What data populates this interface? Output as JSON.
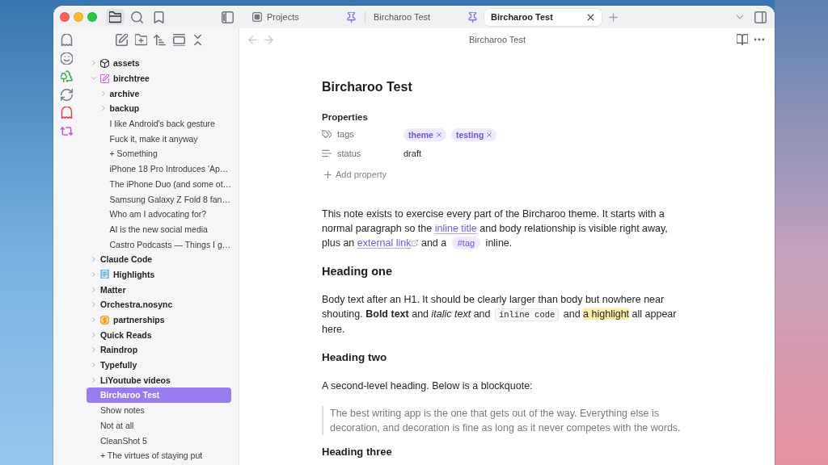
{
  "sidebar_tabs": [
    {
      "selected": true
    },
    {
      "selected": false
    },
    {
      "selected": false
    }
  ],
  "tabs": [
    {
      "kind": "view",
      "label": "Projects",
      "pinned": true,
      "selected": false
    },
    {
      "kind": "note",
      "label": "Bircharoo Test",
      "pinned": true,
      "selected": false
    },
    {
      "kind": "note",
      "label": "Bircharoo Test",
      "pinned": false,
      "selected": true
    }
  ],
  "sidebar": {
    "items": [
      {
        "kind": "folder",
        "label": "assets",
        "expanded": false,
        "selected": false
      },
      {
        "kind": "folder",
        "label": "birchtree",
        "expanded": true,
        "selected": false,
        "children": [
          {
            "kind": "folder",
            "label": "archive",
            "expanded": false,
            "selected": false
          },
          {
            "kind": "folder",
            "label": "backup",
            "expanded": false,
            "selected": false
          },
          {
            "kind": "file",
            "label": "I like Android's back gesture",
            "selected": false
          },
          {
            "kind": "file",
            "label": "Fuck it, make it anyway",
            "selected": false
          },
          {
            "kind": "file",
            "label": "+ Something",
            "selected": false
          },
          {
            "kind": "file",
            "label": "iPhone 18 Pro Introduces 'Ap…",
            "selected": false
          },
          {
            "kind": "file",
            "label": "The iPhone Duo (and some ot…",
            "selected": false
          },
          {
            "kind": "file",
            "label": "Samsung Galaxy Z Fold 8 fan…",
            "selected": false
          },
          {
            "kind": "file",
            "label": "Who am I advocating for?",
            "selected": false
          },
          {
            "kind": "file",
            "label": "AI is the new social media",
            "selected": false
          },
          {
            "kind": "file",
            "label": "Castro Podcasts — Things I g…",
            "selected": false
          }
        ]
      },
      {
        "kind": "folder",
        "label": "Claude Code",
        "expanded": false,
        "selected": false
      },
      {
        "kind": "folder",
        "label": "Highlights",
        "expanded": false,
        "selected": false
      },
      {
        "kind": "folder",
        "label": "Matter",
        "expanded": false,
        "selected": false
      },
      {
        "kind": "folder",
        "label": "Orchestra.nosync",
        "expanded": false,
        "selected": false
      },
      {
        "kind": "folder",
        "label": "partnerships",
        "expanded": false,
        "selected": false
      },
      {
        "kind": "folder",
        "label": "Quick Reads",
        "expanded": false,
        "selected": false
      },
      {
        "kind": "folder",
        "label": "Raindrop",
        "expanded": false,
        "selected": false
      },
      {
        "kind": "folder",
        "label": "Typefully",
        "expanded": false,
        "selected": false
      },
      {
        "kind": "folder",
        "label": "LiYoutube videos",
        "expanded": false,
        "selected": false
      },
      {
        "kind": "file",
        "label": "Bircharoo Test",
        "selected": true
      },
      {
        "kind": "file",
        "label": "Show notes",
        "selected": false
      },
      {
        "kind": "file",
        "label": "Not at all",
        "selected": false
      },
      {
        "kind": "file",
        "label": "CleanShot 5",
        "selected": false
      },
      {
        "kind": "file",
        "label": "+ The virtues of staying put",
        "selected": false
      }
    ]
  },
  "note_header": {
    "title": "Bircharoo Test"
  },
  "note": {
    "title": "Bircharoo Test",
    "properties": {
      "heading": "Properties",
      "items": [
        {
          "kind": "tags",
          "name": "tags",
          "tags": [
            "theme",
            "testing"
          ]
        },
        {
          "kind": "text",
          "name": "status",
          "value": "draft"
        }
      ],
      "add_label": "Add property"
    },
    "blocks": [
      {
        "kind": "paragraph",
        "runs": [
          {
            "kind": "text",
            "text": "This note exists to exercise every part of the Bircharoo theme. It starts with a normal paragraph so the "
          },
          {
            "kind": "internal_link",
            "text": "inline title"
          },
          {
            "kind": "text",
            "text": " and body relationship is visible right away, plus an "
          },
          {
            "kind": "external_link",
            "text": "external link"
          },
          {
            "kind": "text",
            "text": " and a "
          },
          {
            "kind": "tag",
            "text": "#tag"
          },
          {
            "kind": "text",
            "text": " inline."
          }
        ]
      },
      {
        "kind": "h1",
        "text": "Heading one"
      },
      {
        "kind": "paragraph",
        "runs": [
          {
            "kind": "text",
            "text": "Body text after an H1. It should be clearly larger than body but nowhere near shouting. **Bold text** and *italic text* and "
          },
          {
            "kind": "code",
            "text": "inline code"
          },
          {
            "kind": "text",
            "text": " and "
          },
          {
            "kind": "highlight",
            "text": "a highlight"
          },
          {
            "kind": "text",
            "text": " all appear here."
          }
        ]
      },
      {
        "kind": "h2",
        "text": "Heading two"
      },
      {
        "kind": "paragraph",
        "runs": [
          {
            "kind": "text",
            "text": "A second-level heading. Below is a blockquote:"
          }
        ]
      },
      {
        "kind": "blockquote",
        "text": "The best writing app is the one that gets out of the way. Everything else is decoration, and decoration is fine as long as it never competes with the words."
      },
      {
        "kind": "h3",
        "text": "Heading three"
      }
    ]
  }
}
